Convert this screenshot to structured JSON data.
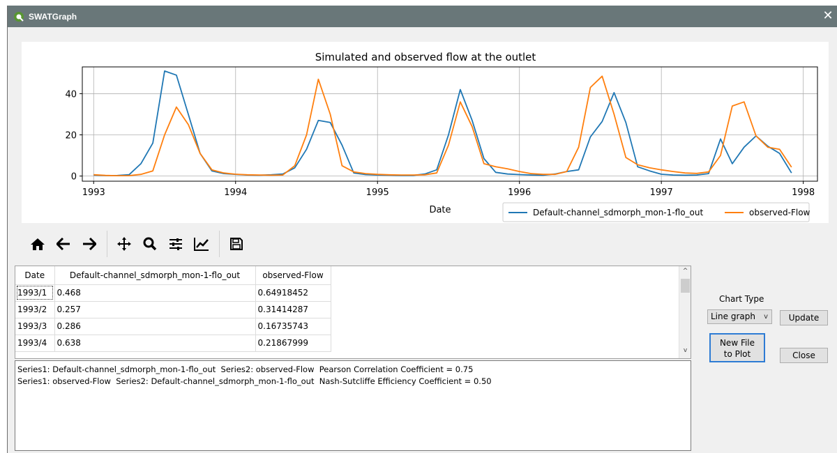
{
  "window": {
    "title": "SWATGraph",
    "close_glyph": "✕"
  },
  "chart_data": {
    "type": "line",
    "title": "Simulated and observed flow at the outlet",
    "xlabel": "Date",
    "ylabel": "",
    "x_ticks": [
      "1993",
      "1994",
      "1995",
      "1996",
      "1997",
      "1998"
    ],
    "y_ticks": [
      "0",
      "20",
      "40"
    ],
    "xlim": [
      1992.92,
      1998.1
    ],
    "ylim": [
      -2.5,
      53
    ],
    "grid": true,
    "legend_position": "bottom-right",
    "x": [
      1993.0,
      1993.083,
      1993.167,
      1993.25,
      1993.333,
      1993.417,
      1993.5,
      1993.583,
      1993.667,
      1993.75,
      1993.833,
      1993.917,
      1994.0,
      1994.083,
      1994.167,
      1994.25,
      1994.333,
      1994.417,
      1994.5,
      1994.583,
      1994.667,
      1994.75,
      1994.833,
      1994.917,
      1995.0,
      1995.083,
      1995.167,
      1995.25,
      1995.333,
      1995.417,
      1995.5,
      1995.583,
      1995.667,
      1995.75,
      1995.833,
      1995.917,
      1996.0,
      1996.083,
      1996.167,
      1996.25,
      1996.333,
      1996.417,
      1996.5,
      1996.583,
      1996.667,
      1996.75,
      1996.833,
      1996.917,
      1997.0,
      1997.083,
      1997.167,
      1997.25,
      1997.333,
      1997.417,
      1997.5,
      1997.583,
      1997.667,
      1997.75,
      1997.833,
      1997.917
    ],
    "series": [
      {
        "name": "Default-channel_sdmorph_mon-1-flo_out",
        "color": "#1f77b4",
        "values": [
          0.468,
          0.257,
          0.286,
          0.638,
          6,
          16,
          51,
          49,
          30,
          11,
          2.5,
          1.2,
          0.8,
          0.5,
          0.4,
          0.6,
          1,
          4,
          13,
          27,
          26,
          15,
          1.5,
          0.7,
          0.5,
          0.4,
          0.3,
          0.3,
          1,
          3,
          20,
          42,
          27,
          8.5,
          1.8,
          1,
          0.7,
          0.5,
          0.4,
          1,
          2.2,
          3,
          19,
          26.5,
          40.5,
          26,
          4.5,
          2.5,
          0.9,
          0.5,
          0.4,
          0.5,
          1.2,
          18,
          6,
          14,
          19.5,
          14.5,
          11,
          1.5
        ]
      },
      {
        "name": "observed-Flow",
        "color": "#ff7f0e",
        "values": [
          0.64918452,
          0.31414287,
          0.16735743,
          0.21867999,
          0.8,
          2.5,
          20,
          33.5,
          25,
          11,
          3,
          1.5,
          0.9,
          0.6,
          0.5,
          0.4,
          0.5,
          5,
          20,
          47,
          30,
          5,
          2,
          1.2,
          0.8,
          0.6,
          0.5,
          0.5,
          0.6,
          1.5,
          15,
          36,
          24,
          6,
          4.5,
          3.5,
          2.2,
          1.2,
          0.8,
          0.8,
          2.2,
          14,
          43,
          48.5,
          30,
          9,
          5.5,
          4,
          3,
          2.2,
          1.5,
          1.3,
          2,
          10,
          34,
          36,
          19.5,
          14,
          13,
          4.3
        ]
      }
    ]
  },
  "toolbar": {
    "icons": [
      "home-icon",
      "back-arrow-icon",
      "forward-arrow-icon",
      "pan-icon",
      "zoom-icon",
      "configure-subplots-icon",
      "edit-axis-icon",
      "save-icon"
    ]
  },
  "table": {
    "headers": [
      "Date",
      "Default-channel_sdmorph_mon-1-flo_out",
      "observed-Flow"
    ],
    "rows": [
      [
        "1993/1",
        "0.468",
        "0.64918452"
      ],
      [
        "1993/2",
        "0.257",
        "0.31414287"
      ],
      [
        "1993/3",
        "0.286",
        "0.16735743"
      ],
      [
        "1993/4",
        "0.638",
        "0.21867999"
      ]
    ],
    "scroll_up": "^",
    "scroll_down": "v"
  },
  "results": {
    "line1": "Series1: Default-channel_sdmorph_mon-1-flo_out  Series2: observed-Flow  Pearson Correlation Coefficient = 0.75",
    "line2": "Series1: observed-Flow  Series2: Default-channel_sdmorph_mon-1-flo_out  Nash-Sutcliffe Efficiency Coefficient = 0.50"
  },
  "controls": {
    "chart_type_label": "Chart Type",
    "chart_type_value": "Line graph",
    "chart_type_arrow": "v",
    "update_label": "Update",
    "new_file_line1": "New File",
    "new_file_line2": "to Plot",
    "close_label": "Close"
  }
}
